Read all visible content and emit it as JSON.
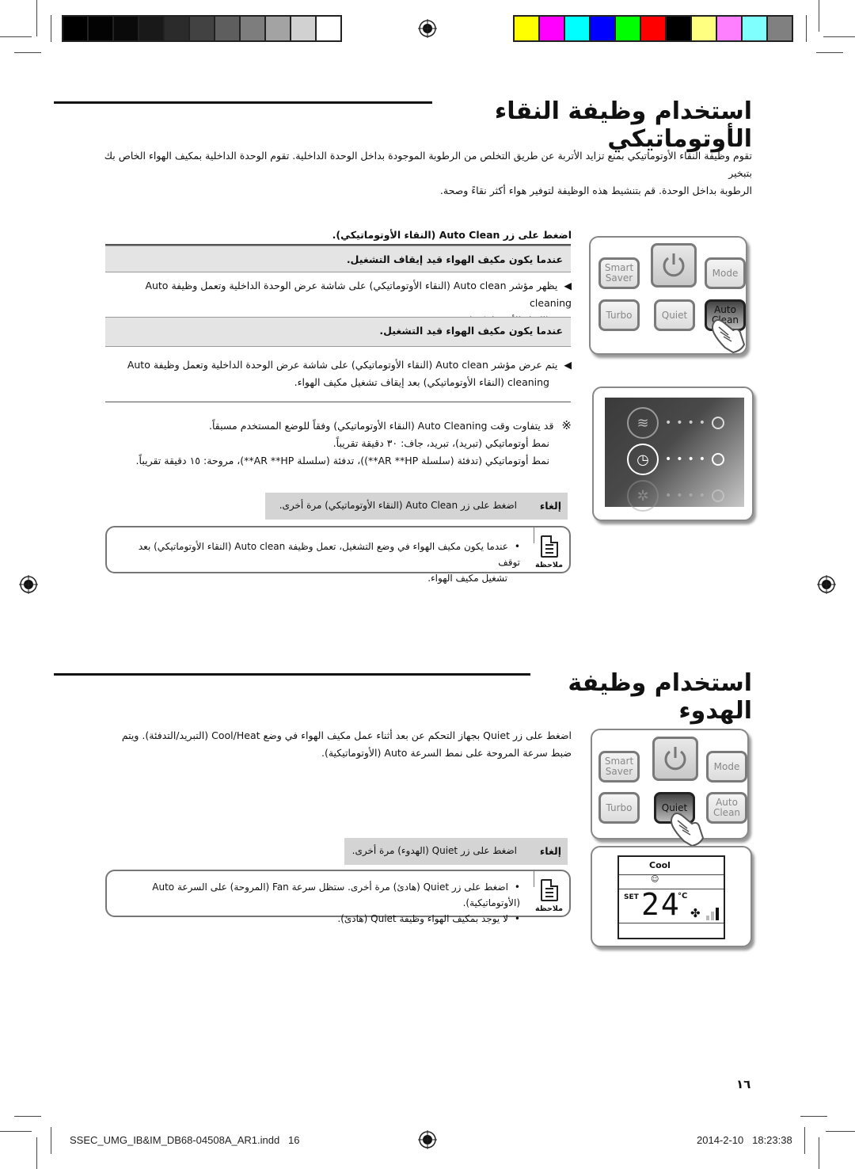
{
  "color_bars": {
    "grayscale": [
      "#000000",
      "#030303",
      "#0a0a0a",
      "#191919",
      "#2b2b2b",
      "#424242",
      "#5e5e5e",
      "#7d7d7d",
      "#a3a3a3",
      "#d1d1d1",
      "#ffffff"
    ],
    "process": [
      "#ffff00",
      "#ff00ff",
      "#00ffff",
      "#0000ff",
      "#00ff00",
      "#ff0000",
      "#000000",
      "#ffff80",
      "#ff80ff",
      "#80ffff",
      "#808080"
    ]
  },
  "section1": {
    "title": "استخدام وظيفة النقاء الأوتوماتيكي",
    "intro_line1": "تقوم وظيفة النقاء الأوتوماتيكي بمنع تزايد الأتربة عن طريق التخلص من الرطوبة الموجودة بداخل الوحدة الداخلية. تقوم الوحدة الداخلية بمكيف الهواء الخاص بك بتبخير",
    "intro_line2": "الرطوبة بداخل الوحدة. قم بتنشيط هذه الوظيفة لتوفير هواء أكثر نقاءً وصحة.",
    "press_instruction": "اضغط على زر Auto Clean (النقاء الأوتوماتيكي).",
    "case_off": {
      "heading": "عندما يكون مكيف الهواء قيد إيقاف التشغيل.",
      "line1": "يظهر مؤشر Auto clean (النقاء الأوتوماتيكي) على شاشة عرض الوحدة الداخلية وتعمل وظيفة Auto cleaning",
      "line2": "(النقاء الأوتوماتيكي)."
    },
    "case_on": {
      "heading": "عندما يكون مكيف الهواء قيد التشغيل.",
      "line1": "يتم عرض مؤشر Auto clean (النقاء الأوتوماتيكي) على شاشة عرض الوحدة الداخلية وتعمل وظيفة Auto",
      "line2": "cleaning (النقاء الأوتوماتيكي) بعد إيقاف تشغيل مكيف الهواء."
    },
    "remark_symbol": "※",
    "remark_line1": "قد يتفاوت وقت Auto Cleaning (النقاء الأوتوماتيكي) وفقاً للوضع المستخدم مسبقاً.",
    "remark_line2": "نمط أوتوماتيكي (تبريد)، تبريد، جاف: ٣٠ دقيقة تقريباً.",
    "remark_line3": "نمط أوتوماتيكي (تدفئة (سلسلة AR **HP**))، تدفئة (سلسلة AR **HP**)، مروحة: ١٥ دقيقة تقريباً.",
    "cancel_label": "إلغاء",
    "cancel_text": "اضغط على زر Auto Clean (النقاء الأوتوماتيكي) مرة أخرى.",
    "note_label": "ملاحظة",
    "note_line1": "عندما يكون مكيف الهواء في وضع التشغيل، تعمل وظيفة Auto clean (النقاء الأوتوماتيكي) بعد توقف",
    "note_line2": "تشغيل مكيف الهواء."
  },
  "section2": {
    "title": "استخدام وظيفة الهدوء",
    "intro_line1": "اضغط على زر Quiet بجهاز التحكم عن بعد أثناء عمل مكيف الهواء في وضع Cool/Heat (التبريد/التدفئة). ويتم",
    "intro_line2": "ضبط سرعة المروحة على نمط السرعة Auto (الأوتوماتيكية).",
    "cancel_label": "إلغاء",
    "cancel_text": "اضغط على زر Quiet (الهدوء) مرة أخرى.",
    "note_label": "ملاحظة",
    "note_line1": "اضغط على زر Quiet (هادئ) مرة أخرى. ستظل سرعة Fan (المروحة) على السرعة Auto (الأوتوماتيكية).",
    "note_line2": "لا يوجد بمكيف الهواء وظيفة Quiet (هادئ)."
  },
  "remote": {
    "smart_saver": "Smart Saver",
    "mode": "Mode",
    "turbo": "Turbo",
    "quiet": "Quiet",
    "auto_clean": "Auto Clean",
    "power_icon": "power-icon"
  },
  "indoor_display": {
    "rows": [
      {
        "icon": "airflow-icon",
        "state": "dim"
      },
      {
        "icon": "timer-icon",
        "state": "active"
      },
      {
        "icon": "auto-clean-icon",
        "state": "faded"
      }
    ]
  },
  "lcd": {
    "mode": "Cool",
    "set_label": "SET",
    "temperature": "24",
    "unit": "°C",
    "fan_level": 3
  },
  "page_number": "١٦",
  "footer": {
    "file": "SSEC_UMG_IB&IM_DB68-04508A_AR1.indd   16",
    "timestamp": "2014-2-10   18:23:38"
  }
}
